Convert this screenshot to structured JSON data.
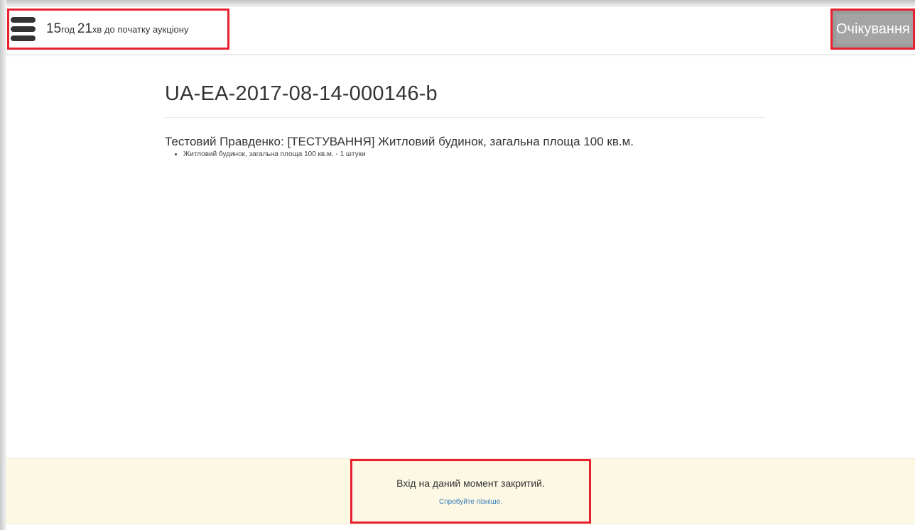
{
  "header": {
    "hours": "15",
    "hours_unit": "год",
    "minutes": "21",
    "minutes_unit": "хв до початку аукціону",
    "status": "Очікування"
  },
  "auction": {
    "id": "UA-EA-2017-08-14-000146-b",
    "title": "Тестовий Правденко: [ТЕСТУВАННЯ] Житловий будинок, загальна площа 100 кв.м.",
    "items": [
      "Житловий будинок, загальна площа 100 кв.м. - 1 штуки"
    ]
  },
  "footer": {
    "message": "Вхід на даний момент закритий.",
    "link": "Спробуйте пізніше."
  },
  "colors": {
    "highlight": "#e8202f",
    "status_bg": "#a4a4a4",
    "notice_bg": "#fcf8e3",
    "link": "#337ab7"
  },
  "icons": [
    "menu-icon"
  ]
}
